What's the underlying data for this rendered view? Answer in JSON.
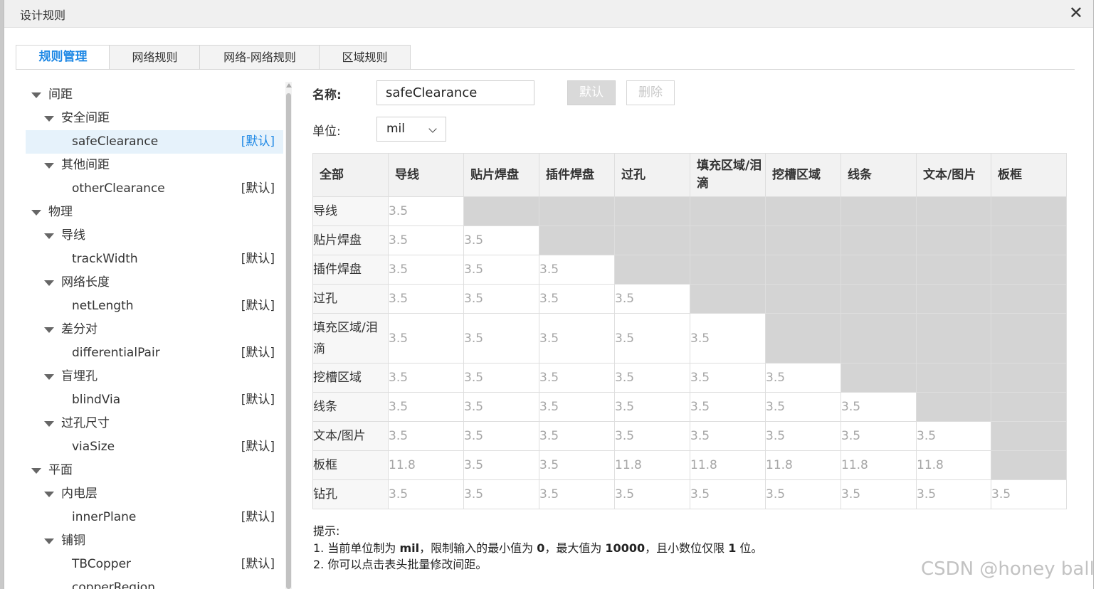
{
  "dialog": {
    "title": "设计规则"
  },
  "tabs": [
    "规则管理",
    "网络规则",
    "网络-网络规则",
    "区域规则"
  ],
  "tree": [
    {
      "label": "间距",
      "level": 0,
      "expanded": true
    },
    {
      "label": "安全间距",
      "level": 1,
      "expanded": true
    },
    {
      "label": "safeClearance",
      "level": 2,
      "tag": "[默认]",
      "selected": true
    },
    {
      "label": "其他间距",
      "level": 1,
      "expanded": true
    },
    {
      "label": "otherClearance",
      "level": 2,
      "tag": "[默认]"
    },
    {
      "label": "物理",
      "level": 0,
      "expanded": true
    },
    {
      "label": "导线",
      "level": 1,
      "expanded": true
    },
    {
      "label": "trackWidth",
      "level": 2,
      "tag": "[默认]"
    },
    {
      "label": "网络长度",
      "level": 1,
      "expanded": true
    },
    {
      "label": "netLength",
      "level": 2,
      "tag": "[默认]"
    },
    {
      "label": "差分对",
      "level": 1,
      "expanded": true
    },
    {
      "label": "differentialPair",
      "level": 2,
      "tag": "[默认]"
    },
    {
      "label": "盲埋孔",
      "level": 1,
      "expanded": true
    },
    {
      "label": "blindVia",
      "level": 2,
      "tag": "[默认]"
    },
    {
      "label": "过孔尺寸",
      "level": 1,
      "expanded": true
    },
    {
      "label": "viaSize",
      "level": 2,
      "tag": "[默认]"
    },
    {
      "label": "平面",
      "level": 0,
      "expanded": true
    },
    {
      "label": "内电层",
      "level": 1,
      "expanded": true
    },
    {
      "label": "innerPlane",
      "level": 2,
      "tag": "[默认]"
    },
    {
      "label": "铺铜",
      "level": 1,
      "expanded": true
    },
    {
      "label": "TBCopper",
      "level": 2,
      "tag": "[默认]"
    },
    {
      "label": "copperRegion",
      "level": 2,
      "tag": ""
    }
  ],
  "form": {
    "name_label": "名称:",
    "name_value": "safeClearance",
    "default_button": "默认",
    "delete_button": "删除",
    "unit_label": "单位:",
    "unit_value": "mil"
  },
  "matrix": {
    "corner": "全部",
    "columns": [
      "导线",
      "贴片焊盘",
      "插件焊盘",
      "过孔",
      "填充区域/泪滴",
      "挖槽区域",
      "线条",
      "文本/图片",
      "板框"
    ],
    "rows": [
      {
        "label": "导线",
        "values": [
          "3.5"
        ]
      },
      {
        "label": "贴片焊盘",
        "values": [
          "3.5",
          "3.5"
        ]
      },
      {
        "label": "插件焊盘",
        "values": [
          "3.5",
          "3.5",
          "3.5"
        ]
      },
      {
        "label": "过孔",
        "values": [
          "3.5",
          "3.5",
          "3.5",
          "3.5"
        ]
      },
      {
        "label": "填充区域/泪滴",
        "values": [
          "3.5",
          "3.5",
          "3.5",
          "3.5",
          "3.5"
        ]
      },
      {
        "label": "挖槽区域",
        "values": [
          "3.5",
          "3.5",
          "3.5",
          "3.5",
          "3.5",
          "3.5"
        ]
      },
      {
        "label": "线条",
        "values": [
          "3.5",
          "3.5",
          "3.5",
          "3.5",
          "3.5",
          "3.5",
          "3.5"
        ]
      },
      {
        "label": "文本/图片",
        "values": [
          "3.5",
          "3.5",
          "3.5",
          "3.5",
          "3.5",
          "3.5",
          "3.5",
          "3.5"
        ]
      },
      {
        "label": "板框",
        "values": [
          "11.8",
          "3.5",
          "3.5",
          "11.8",
          "11.8",
          "11.8",
          "11.8",
          "11.8"
        ]
      },
      {
        "label": "钻孔",
        "values": [
          "3.5",
          "3.5",
          "3.5",
          "3.5",
          "3.5",
          "3.5",
          "3.5",
          "3.5",
          "3.5"
        ]
      }
    ]
  },
  "hints": {
    "title": "提示:",
    "line1_pre": "1. 当前单位制为 ",
    "line1_unit": "mil",
    "line1_mid": "，限制输入的最小值为 ",
    "line1_min": "0",
    "line1_mid2": "，最大值为 ",
    "line1_max": "10000",
    "line1_mid3": "，且小数位仅限 ",
    "line1_dec": "1",
    "line1_post": " 位。",
    "line2": "2. 你可以点击表头批量修改间距。"
  },
  "watermark": "CSDN @honey ball",
  "colors": {
    "accent": "#1e88e5",
    "blocked_cell": "#d4d4d4",
    "value_text": "#a6a6a6"
  }
}
